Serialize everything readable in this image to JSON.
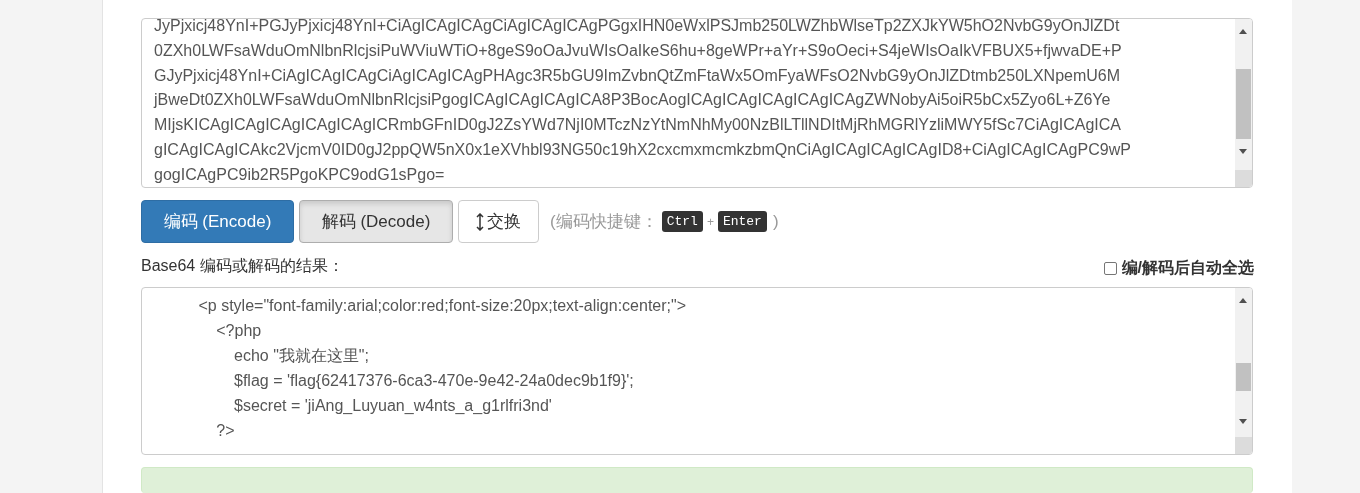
{
  "input_box": {
    "lines": [
      "JyPjxicj48YnI+PGJyPjxicj48YnI+CiAgICAgICAgCiAgICAgICAgPGgxIHN0eWxlPSJmb250LWZhbWlseTp2ZXJkYW5hO2NvbG9yOnJlZDt",
      "0ZXh0LWFsaWduOmNlbnRlcjsiPuWViuWTiO+8geS9oOaJvuWIsOaIkeS6hu+8geWPr+aYr+S9oOeci+S4jeWIsOaIkVFBUX5+fjwvaDE+P",
      "GJyPjxicj48YnI+CiAgICAgICAgCiAgICAgICAgPHAgc3R5bGU9ImZvbnQtZmFtaWx5OmFyaWFsO2NvbG9yOnJlZDtmb250LXNpemU6M",
      "jBweDt0ZXh0LWFsaWduOmNlbnRlcjsiPgogICAgICAgICAgICA8P3BocAogICAgICAgICAgICAgICAgZWNobyAi5oiR5bCx5Zyo6L+Z6Ye",
      "MIjsKICAgICAgICAgICAgICAgICRmbGFnID0gJ2ZsYWd7NjI0MTczNzYtNmNhMy00NzBlLTllNDItMjRhMGRlYzliMWY5fSc7CiAgICAgICA",
      "gICAgICAgICAkc2VjcmV0ID0gJ2ppQW5nX0x1eXVhbl93NG50c19hX2cxcmxmcmkzbmQnCiAgICAgICAgICAgID8+CiAgICAgICAgPC9wP",
      "gogICAgPC9ib2R5PgoKPC9odG1sPgo="
    ]
  },
  "buttons": [
    {
      "kind": "primary",
      "label": "编码 (Encode)",
      "selected": false
    },
    {
      "kind": "default",
      "label": "解码 (Decode)",
      "selected": true
    },
    {
      "kind": "swap",
      "label": "交换",
      "selected": false
    }
  ],
  "shortcut": {
    "open": "(编码快捷键：",
    "keys": [
      "Ctrl",
      "Enter"
    ],
    "plus": "+",
    "close": ")"
  },
  "result_label": "Base64 编码或解码的结果：",
  "auto_select": {
    "label": "编/解码后自动全选",
    "checked": false
  },
  "result_box": {
    "lines": [
      "          <p style=\"font-family:arial;color:red;font-size:20px;text-align:center;\">",
      "              <?php",
      "                  echo \"我就在这里\";",
      "                  $flag = 'flag{62417376-6ca3-470e-9e42-24a0dec9b1f9}';",
      "                  $secret = 'jiAng_Luyuan_w4nts_a_g1rlfri3nd'",
      "              ?>"
    ]
  }
}
